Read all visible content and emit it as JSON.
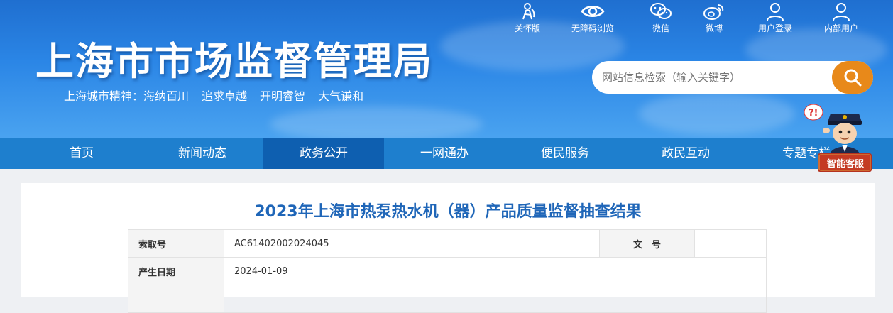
{
  "header": {
    "title": "上海市市场监督管理局",
    "spirit_label": "上海城市精神：",
    "spirit_items": [
      "海纳百川",
      "追求卓越",
      "开明睿智",
      "大气谦和"
    ]
  },
  "tools": [
    {
      "label": "关怀版",
      "icon": "care-mode-icon"
    },
    {
      "label": "无障碍浏览",
      "icon": "eye-icon"
    },
    {
      "label": "微信",
      "icon": "wechat-icon"
    },
    {
      "label": "微博",
      "icon": "weibo-icon"
    },
    {
      "label": "用户登录",
      "icon": "user-icon"
    },
    {
      "label": "内部用户",
      "icon": "user-icon"
    }
  ],
  "search": {
    "placeholder": "网站信息检索（输入关键字）",
    "button_color": "#e8891a"
  },
  "nav": {
    "items": [
      "首页",
      "新闻动态",
      "政务公开",
      "一网通办",
      "便民服务",
      "政民互动",
      "专题专栏"
    ],
    "active": "政务公开"
  },
  "assistant": {
    "label": "智能客服"
  },
  "document": {
    "title": "2023年上海市热泵热水机（器）产品质量监督抽查结果",
    "rows": [
      {
        "label": "索取号",
        "value": "AC61402002024045",
        "label2": "文　号",
        "value2": ""
      },
      {
        "label": "产生日期",
        "value": "2024-01-09"
      }
    ]
  },
  "colors": {
    "header_blue": "#2b86e6",
    "nav_blue": "#1e7fce",
    "nav_active": "#0e5fb0",
    "title_blue": "#1f66b8"
  }
}
